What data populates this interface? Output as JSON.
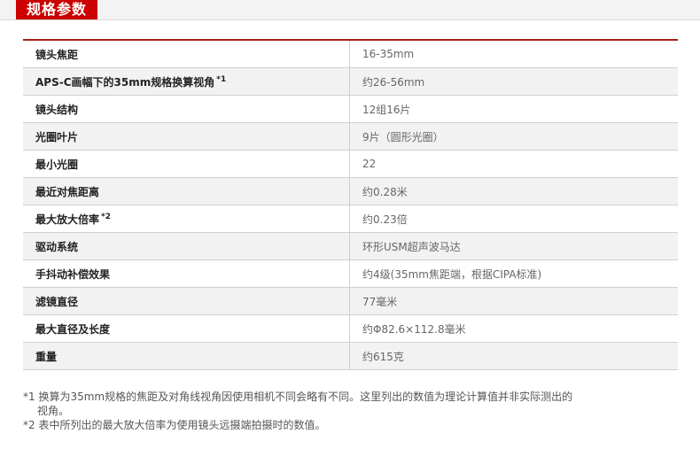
{
  "header": {
    "title": "规格参数"
  },
  "specs": [
    {
      "label": "镜头焦距",
      "sup": "",
      "value": "16-35mm"
    },
    {
      "label": "APS-C画幅下的35mm规格换算视角",
      "sup": "*1",
      "value": "约26-56mm"
    },
    {
      "label": "镜头结构",
      "sup": "",
      "value": "12组16片"
    },
    {
      "label": "光圈叶片",
      "sup": "",
      "value": "9片（圆形光圈）"
    },
    {
      "label": "最小光圈",
      "sup": "",
      "value": "22"
    },
    {
      "label": "最近对焦距离",
      "sup": "",
      "value": "约0.28米"
    },
    {
      "label": "最大放大倍率",
      "sup": "*2",
      "value": "约0.23倍"
    },
    {
      "label": "驱动系统",
      "sup": "",
      "value": "环形USM超声波马达"
    },
    {
      "label": "手抖动补偿效果",
      "sup": "",
      "value": "约4级(35mm焦距端，根据CIPA标准)"
    },
    {
      "label": "滤镜直径",
      "sup": "",
      "value": "77毫米"
    },
    {
      "label": "最大直径及长度",
      "sup": "",
      "value": "约Φ82.6×112.8毫米"
    },
    {
      "label": "重量",
      "sup": "",
      "value": "约615克"
    }
  ],
  "notes": {
    "note1_line1": "*1 换算为35mm规格的焦距及对角线视角因使用相机不同会略有不同。这里列出的数值为理论计算值并非实际测出的",
    "note1_line2": "视角。",
    "note2": "*2 表中所列出的最大放大倍率为使用镜头远摄端拍摄时的数值。"
  },
  "colors": {
    "accent": "#cc0000",
    "rule": "#a81d1d",
    "alt_row": "#f2f2f2"
  }
}
